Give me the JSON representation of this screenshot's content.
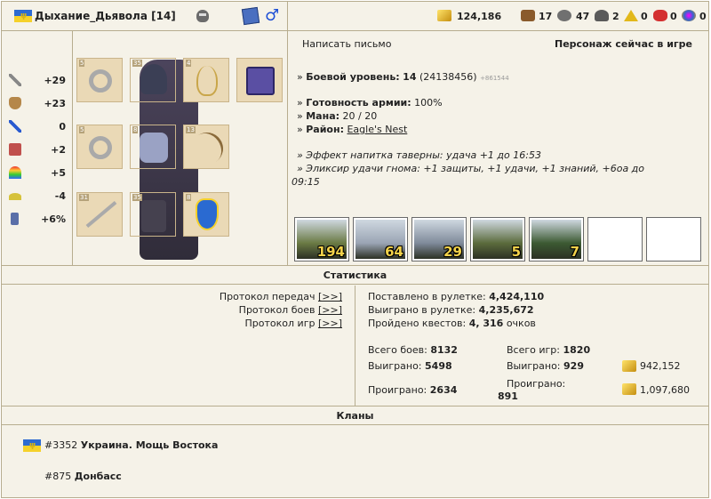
{
  "header": {
    "hero_name": "Дыхание_Дьявола",
    "hero_level": "[14]",
    "resources": [
      {
        "icon": "gold-icon",
        "value": "124,186"
      },
      {
        "icon": "wood-icon",
        "value": "17"
      },
      {
        "icon": "ore-icon",
        "value": "47"
      },
      {
        "icon": "mercury-icon",
        "value": "2"
      },
      {
        "icon": "sulfur-icon",
        "value": "0"
      },
      {
        "icon": "crystal-icon",
        "value": "0"
      },
      {
        "icon": "gems-icon",
        "value": "0"
      }
    ]
  },
  "stats": [
    {
      "icon": "attack-icon",
      "value": "+29"
    },
    {
      "icon": "defense-icon",
      "value": "+23"
    },
    {
      "icon": "spellpower-icon",
      "value": "0"
    },
    {
      "icon": "knowledge-icon",
      "value": "+2"
    },
    {
      "icon": "luck-icon",
      "value": "+5"
    },
    {
      "icon": "morale-icon",
      "value": "-4"
    },
    {
      "icon": "initiative-icon",
      "value": "+6%"
    }
  ],
  "equipment": {
    "slot_levels": [
      "5",
      "35",
      "4",
      "",
      "5",
      "8",
      "13",
      "31",
      "35",
      "8"
    ]
  },
  "profile": {
    "write_letter": "Написать письмо",
    "online_status": "Персонаж сейчас в игре",
    "combat_label": "Боевой уровень:",
    "combat_value": "14",
    "combat_exp": "(24138456)",
    "combat_small": "+861544",
    "army_label": "Готовность армии:",
    "army_value": "100%",
    "mana_label": "Мана:",
    "mana_value": "20 / 20",
    "district_label": "Район:",
    "district_value": "Eagle's Nest",
    "effect1": "» Эффект напитка таверны: удача +1 до 16:53",
    "effect2a": "» Эликсир удачи гнома: +1 защиты, +1 удачи, +1 знаний, +6оа до",
    "effect2b": "09:15"
  },
  "army": [
    {
      "icon": "orc-warrior-icon",
      "count": "194",
      "color": "#6a7a44"
    },
    {
      "icon": "ghost-knight-icon",
      "count": "64",
      "color": "#9aa4b4"
    },
    {
      "icon": "vampire-icon",
      "count": "29",
      "color": "#7f8a9a"
    },
    {
      "icon": "goblin-shaman-icon",
      "count": "5",
      "color": "#5b6b3c"
    },
    {
      "icon": "orc-archer-icon",
      "count": "7",
      "color": "#3c5a32"
    },
    {
      "icon": "",
      "count": "",
      "color": "#ffffff"
    },
    {
      "icon": "",
      "count": "",
      "color": "#ffffff"
    }
  ],
  "statistics": {
    "title": "Статистика",
    "proto_transfers": "Протокол передач",
    "proto_battles": "Протокол боев",
    "proto_games": "Протокол игр",
    "proto_link": "[>>]",
    "roulette_bet_label": "Поставлено в рулетке:",
    "roulette_bet": "4,424,110",
    "roulette_win_label": "Выиграно в рулетке:",
    "roulette_win": "4,235,672",
    "quests_label": "Пройдено квестов:",
    "quests_value": "4, 316",
    "quests_unit": "очков",
    "battles_total_label": "Всего боев:",
    "battles_total": "8132",
    "battles_won_label": "Выиграно:",
    "battles_won": "5498",
    "battles_lost_label": "Проиграно:",
    "battles_lost": "2634",
    "games_total_label": "Всего игр:",
    "games_total": "1820",
    "games_won_label": "Выиграно:",
    "games_won": "929",
    "games_won_gold": "942,152",
    "games_lost_label": "Проиграно:",
    "games_lost": "891",
    "games_lost_gold": "1,097,680"
  },
  "clans": {
    "title": "Кланы",
    "items": [
      {
        "id": "#3352",
        "name": "Украина. Мощь Востока"
      },
      {
        "id": "#875",
        "name": "Донбасс"
      }
    ]
  }
}
